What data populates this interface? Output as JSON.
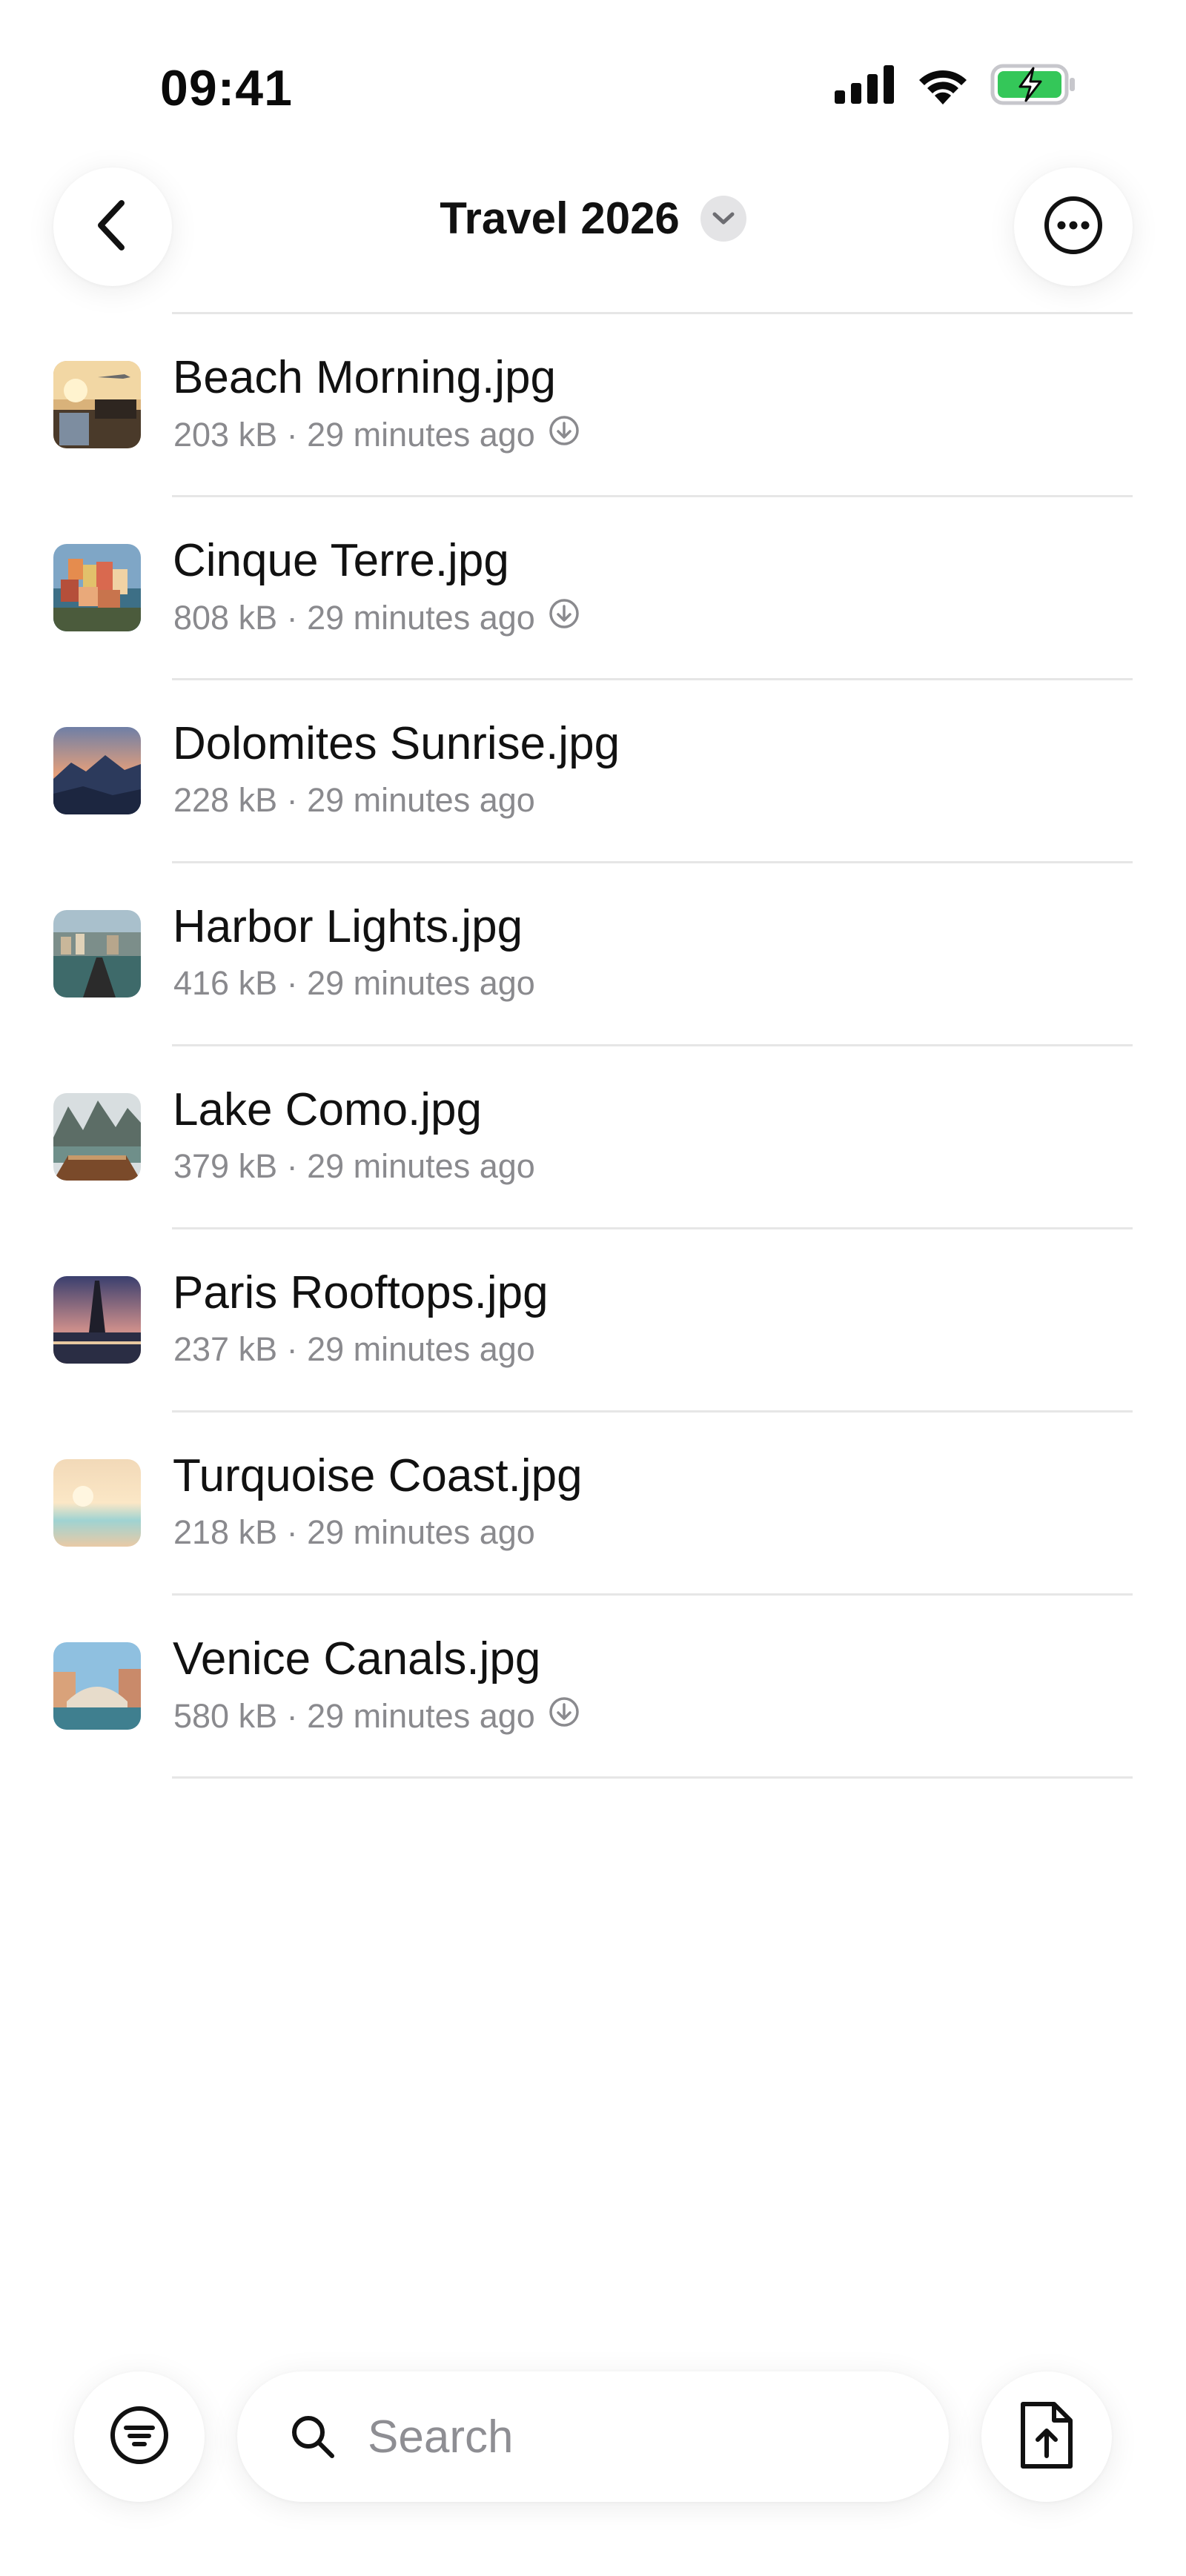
{
  "status_bar": {
    "time": "09:41",
    "icons": [
      "cellular-signal-icon",
      "wifi-icon",
      "battery-charging-icon"
    ],
    "battery_color": "#34c759"
  },
  "header": {
    "title": "Travel 2026",
    "back_icon": "chevron-left-icon",
    "title_menu_icon": "chevron-down-icon",
    "more_icon": "ellipsis-circle-icon"
  },
  "files": [
    {
      "name": "Beach Morning.jpg",
      "meta": "203 kB · 29 minutes ago",
      "downloadable": true
    },
    {
      "name": "Cinque Terre.jpg",
      "meta": "808 kB · 29 minutes ago",
      "downloadable": true
    },
    {
      "name": "Dolomites Sunrise.jpg",
      "meta": "228 kB · 29 minutes ago",
      "downloadable": false
    },
    {
      "name": "Harbor Lights.jpg",
      "meta": "416 kB · 29 minutes ago",
      "downloadable": false
    },
    {
      "name": "Lake Como.jpg",
      "meta": "379 kB · 29 minutes ago",
      "downloadable": false
    },
    {
      "name": "Paris Rooftops.jpg",
      "meta": "237 kB · 29 minutes ago",
      "downloadable": false
    },
    {
      "name": "Turquoise Coast.jpg",
      "meta": "218 kB · 29 minutes ago",
      "downloadable": false
    },
    {
      "name": "Venice Canals.jpg",
      "meta": "580 kB · 29 minutes ago",
      "downloadable": true
    }
  ],
  "bottom_bar": {
    "filter_icon": "filter-lines-icon",
    "search_placeholder": "Search",
    "search_icon": "search-icon",
    "upload_icon": "file-upload-icon"
  }
}
